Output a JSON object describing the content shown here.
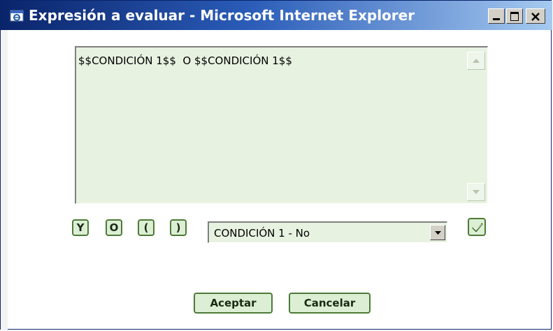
{
  "window": {
    "title": "Expresión a evaluar - Microsoft Internet Explorer",
    "controls": [
      "minimize",
      "maximize",
      "close"
    ]
  },
  "expression": {
    "text": "$$CONDICIÓN 1$$  O $$CONDICIÓN 1$$"
  },
  "operators": {
    "and_label": "Y",
    "or_label": "O",
    "open_paren_label": "(",
    "close_paren_label": ")"
  },
  "condition_select": {
    "selected": "CONDICIÓN 1 - No"
  },
  "actions": {
    "accept_label": "Aceptar",
    "cancel_label": "Cancelar"
  },
  "icons": {
    "app": "ie-window-icon",
    "scroll_up": "scroll-up-arrow-icon",
    "scroll_down": "scroll-down-arrow-icon",
    "dropdown": "dropdown-arrow-icon",
    "validate": "checkmark-icon"
  },
  "colors": {
    "titlebar_start": "#0a246a",
    "titlebar_end": "#a6caf0",
    "field_background": "#e8f2e1",
    "button_background": "#dcefd4",
    "button_border": "#4d7a37"
  }
}
